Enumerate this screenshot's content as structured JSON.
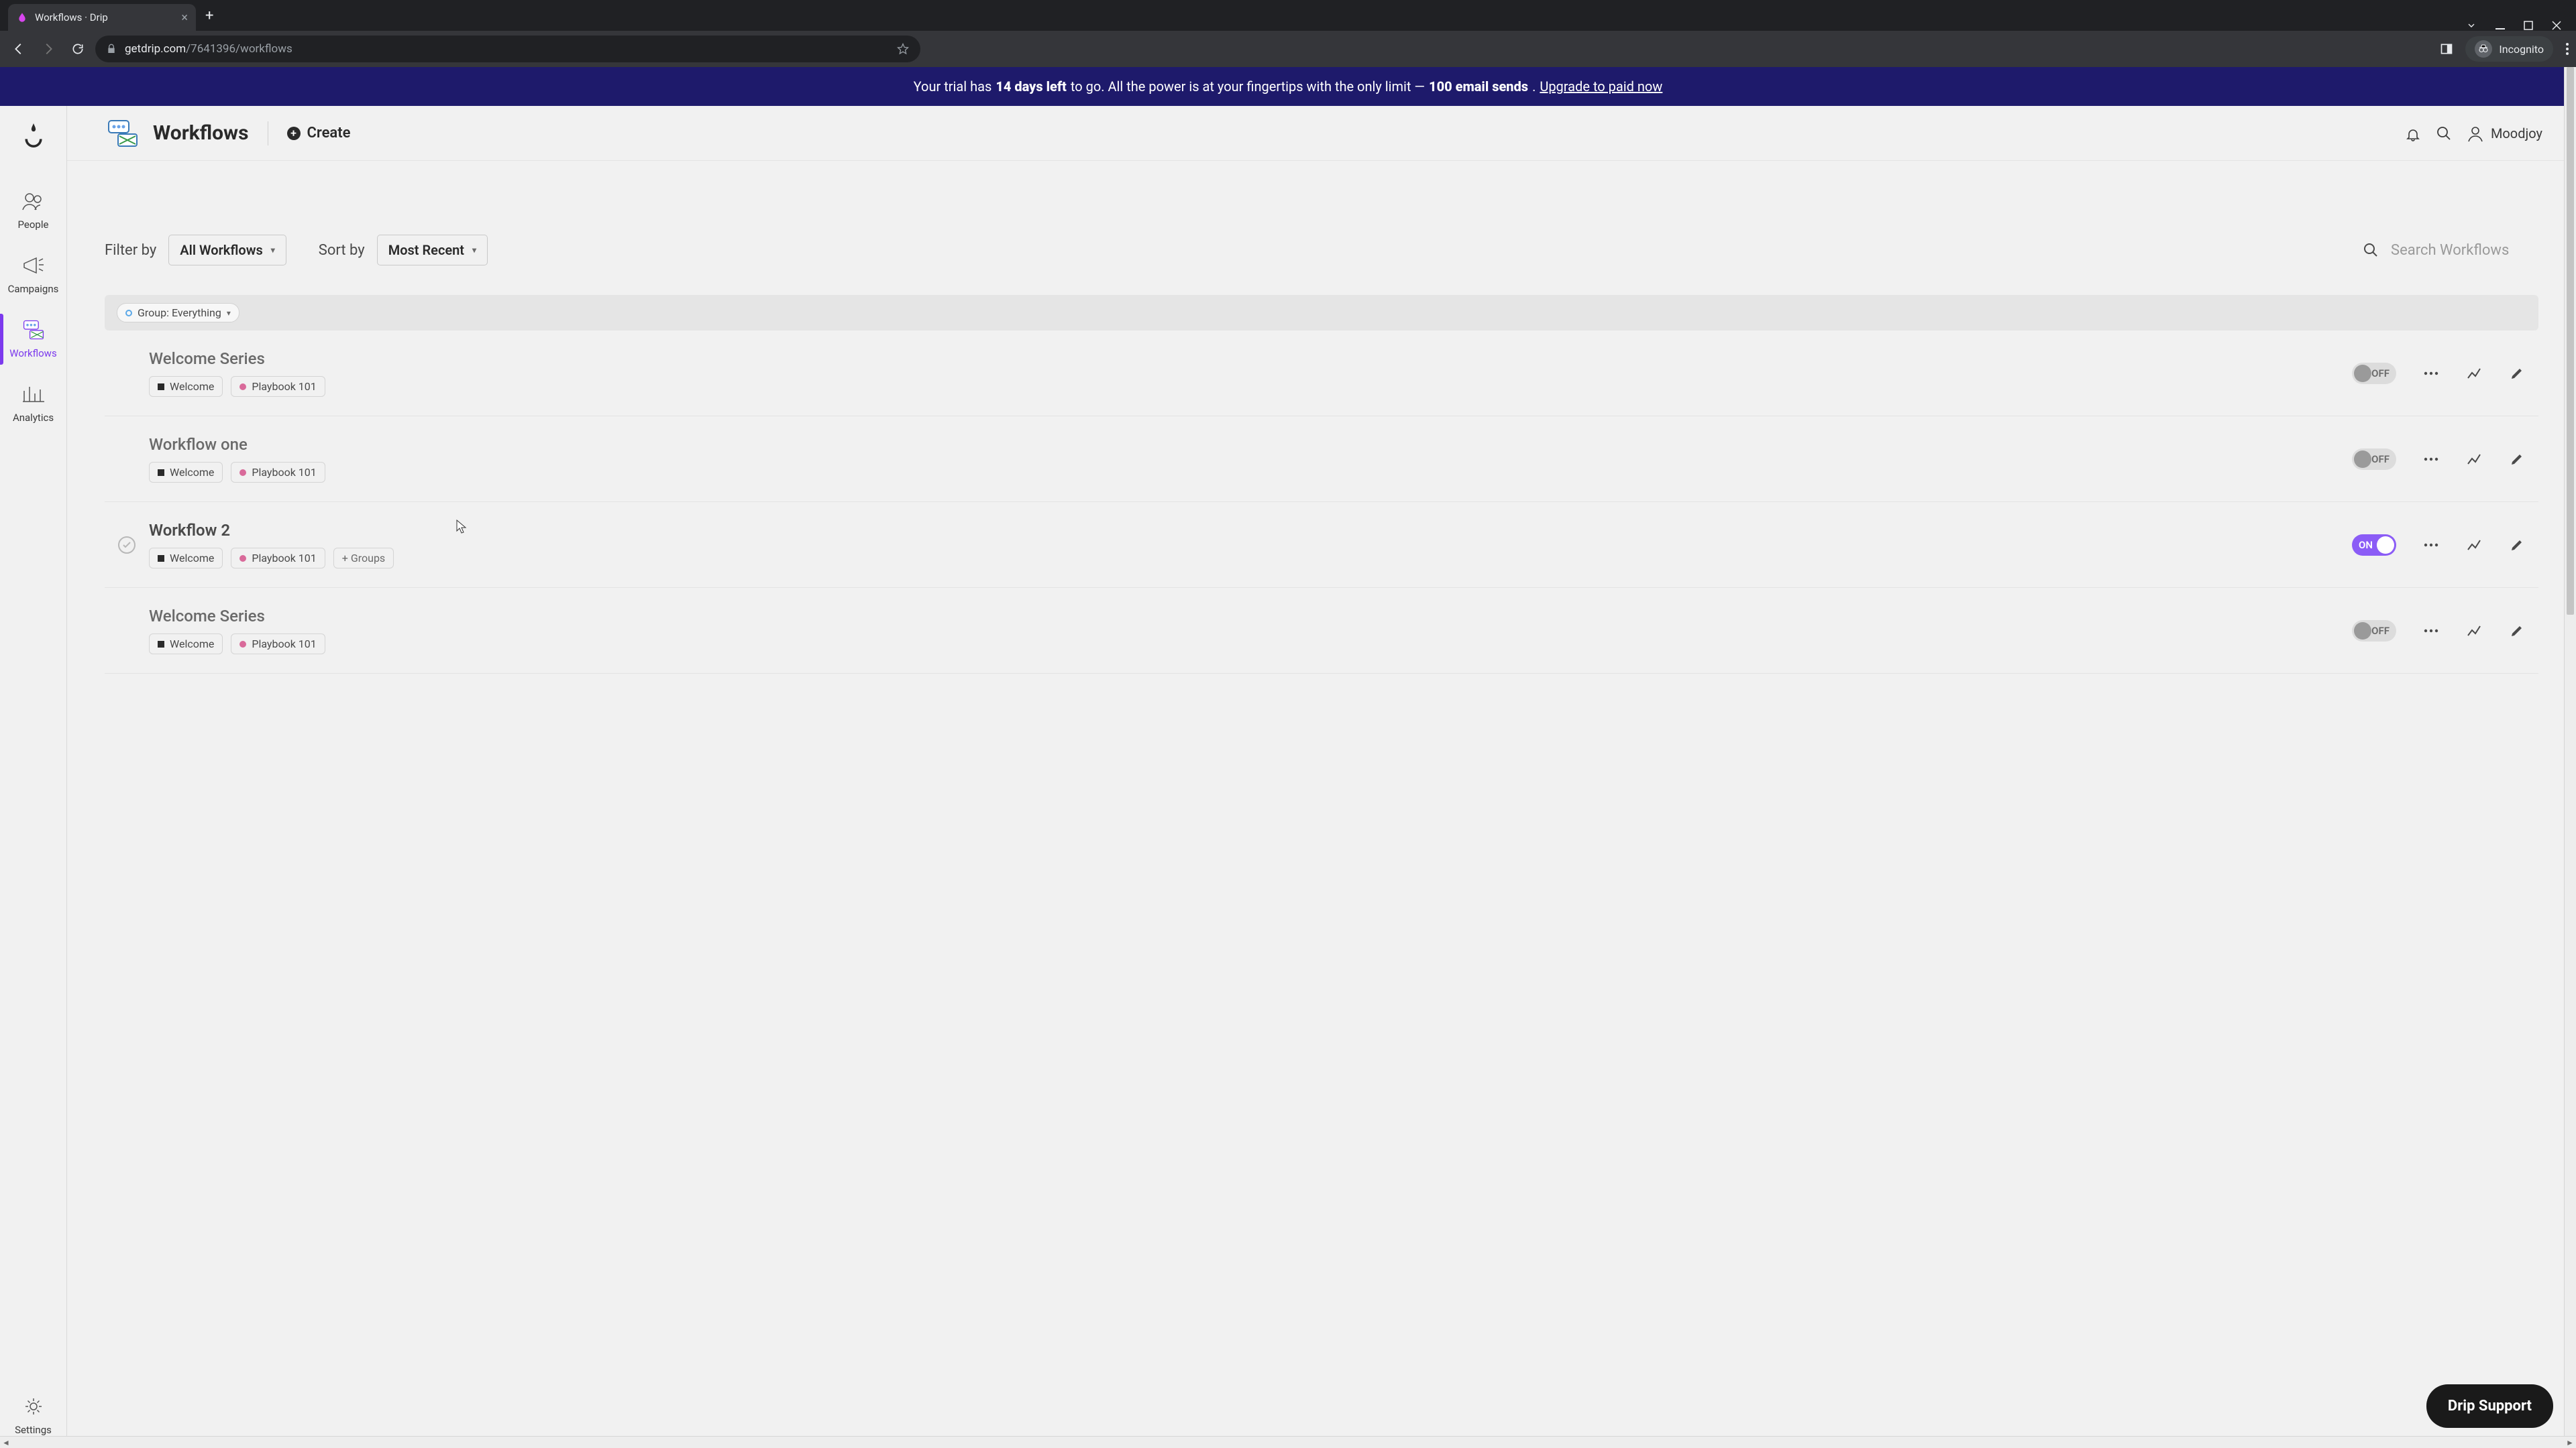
{
  "browser": {
    "tab_title": "Workflows · Drip",
    "url_host": "getdrip.com",
    "url_path": "/7641396/workflows",
    "incognito_label": "Incognito"
  },
  "banner": {
    "pre": "Your trial has ",
    "days": "14 days left",
    "mid": " to go. All the power is at your fingertips with the only limit — ",
    "limit": "100 email sends",
    "post": ". ",
    "link": "Upgrade to paid now"
  },
  "sidebar": {
    "items": [
      {
        "label": "People"
      },
      {
        "label": "Campaigns"
      },
      {
        "label": "Workflows"
      },
      {
        "label": "Analytics"
      }
    ],
    "settings": "Settings"
  },
  "topbar": {
    "title": "Workflows",
    "create": "Create",
    "user": "Moodjoy"
  },
  "controls": {
    "filter_label": "Filter by",
    "filter_value": "All Workflows",
    "sort_label": "Sort by",
    "sort_value": "Most Recent",
    "search_placeholder": "Search Workflows"
  },
  "group": {
    "label": "Group: Everything"
  },
  "workflows": [
    {
      "name": "Welcome Series",
      "tags": [
        "Welcome",
        "Playbook 101"
      ],
      "on": false,
      "hovered": false,
      "extra": false
    },
    {
      "name": "Workflow one",
      "tags": [
        "Welcome",
        "Playbook 101"
      ],
      "on": false,
      "hovered": false,
      "extra": false
    },
    {
      "name": "Workflow 2",
      "tags": [
        "Welcome",
        "Playbook 101"
      ],
      "on": true,
      "hovered": true,
      "extra": true,
      "extra_label": "+ Groups"
    },
    {
      "name": "Welcome Series",
      "tags": [
        "Welcome",
        "Playbook 101"
      ],
      "on": false,
      "hovered": false,
      "extra": false
    }
  ],
  "toggle_labels": {
    "on": "ON",
    "off": "OFF"
  },
  "support": "Drip Support"
}
